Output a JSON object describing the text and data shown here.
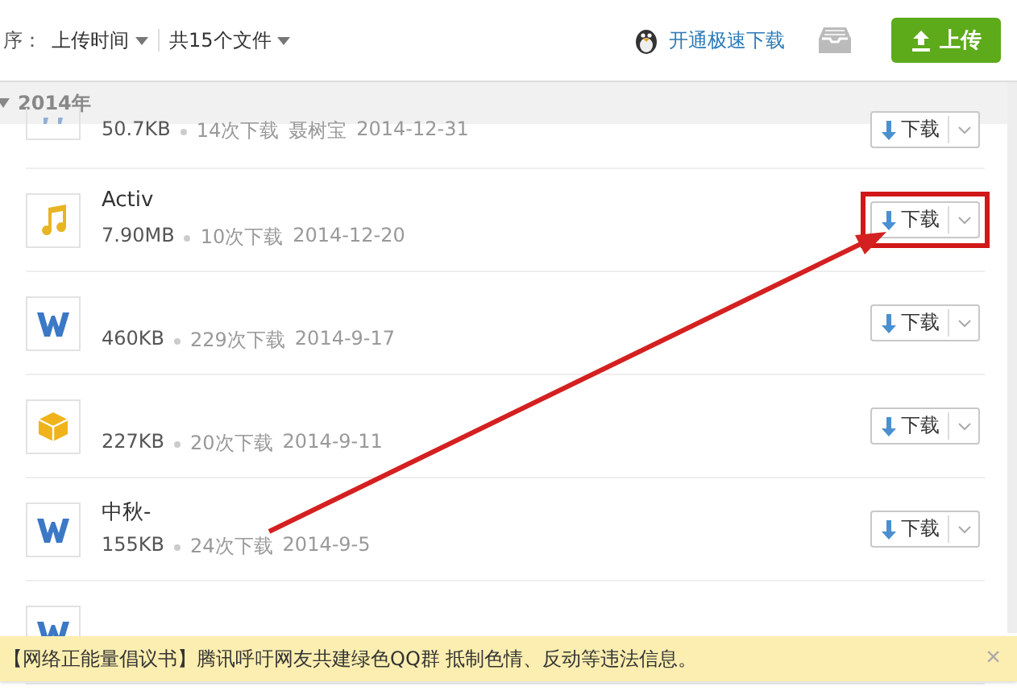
{
  "toolbar": {
    "sort_label": "序：",
    "sort_value": "上传时间",
    "count_label": "共15个文件",
    "speed_link": "开通极速下载",
    "upload_button": "上传"
  },
  "group": {
    "title": "2014年",
    "expanded": true
  },
  "files": [
    {
      "kind": "partial",
      "size": "50.7KB",
      "downloads": "14次下载",
      "uploader": "聂树宝",
      "date": "2014-12-31",
      "button": "下载",
      "highlighted": false
    },
    {
      "kind": "music",
      "name": "Activ",
      "size": "7.90MB",
      "downloads": "10次下载",
      "date": "2014-12-20",
      "button": "下载",
      "highlighted": true
    },
    {
      "kind": "word",
      "size": "460KB",
      "downloads": "229次下载",
      "date": "2014-9-17",
      "button": "下载",
      "highlighted": false
    },
    {
      "kind": "package",
      "size": "227KB",
      "downloads": "20次下载",
      "date": "2014-9-11",
      "button": "下载",
      "highlighted": false
    },
    {
      "kind": "word",
      "name": "中秋-",
      "size": "155KB",
      "downloads": "24次下载",
      "date": "2014-9-5",
      "button": "下载",
      "highlighted": false
    },
    {
      "kind": "word"
    }
  ],
  "banner": {
    "text": "【网络正能量倡议书】腾讯呼吁网友共建绿色QQ群 抵制色情、反动等违法信息。",
    "close": "×"
  }
}
